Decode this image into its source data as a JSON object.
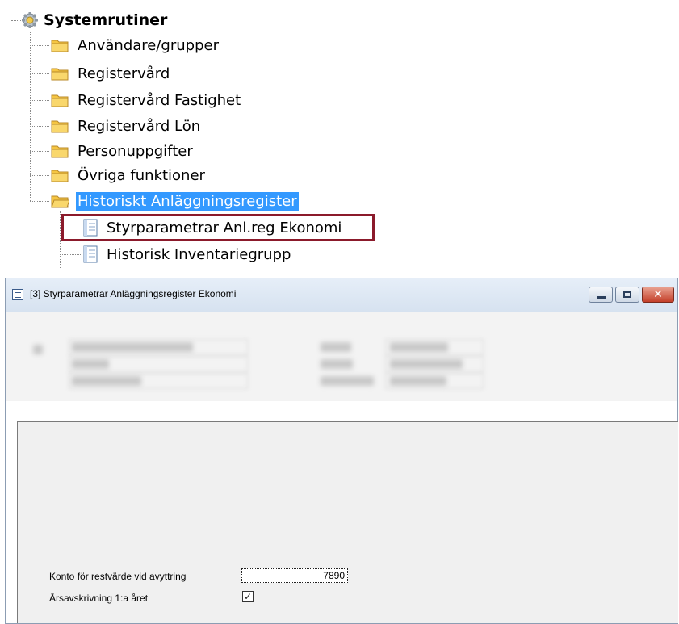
{
  "tree": {
    "root_label": "Systemrutiner",
    "folders": [
      {
        "label": "Användare/grupper"
      },
      {
        "label": "Registervård"
      },
      {
        "label": "Registervård Fastighet"
      },
      {
        "label": "Registervård Lön"
      },
      {
        "label": "Personuppgifter"
      },
      {
        "label": "Övriga funktioner"
      },
      {
        "label": "Historiskt Anläggningsregister",
        "selected": true
      }
    ],
    "children": [
      {
        "label": "Styrparametrar Anl.reg Ekonomi",
        "highlighted": true
      },
      {
        "label": "Historisk Inventariegrupp"
      }
    ]
  },
  "window": {
    "title": "[3]  Styrparametrar Anläggningsregister Ekonomi",
    "close_symbol": "✕",
    "fields": {
      "konto_label": "Konto för restvärde vid avyttring",
      "konto_value": "7890",
      "arsavskrivning_label": "Årsavskrivning 1:a året",
      "arsavskrivning_checked": true,
      "check_symbol": "✓"
    }
  },
  "colors": {
    "selection": "#3399ff",
    "highlight_border": "#8b1a2b",
    "folder": "#f5c542"
  }
}
